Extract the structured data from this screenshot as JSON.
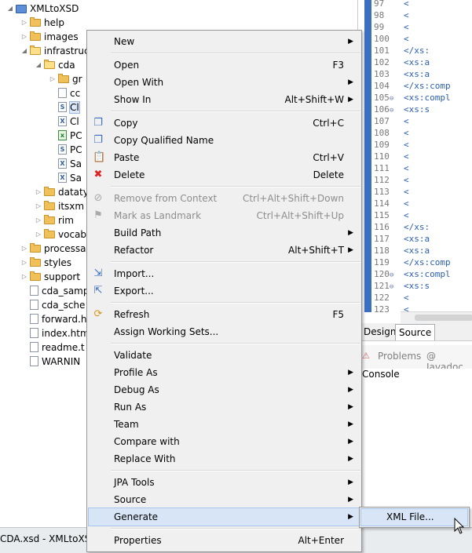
{
  "tree": [
    {
      "label": "XMLtoXSD",
      "icon": "project",
      "twisty": "open",
      "indent": 0
    },
    {
      "label": "help",
      "icon": "folder",
      "twisty": "closed",
      "indent": 1
    },
    {
      "label": "images",
      "icon": "folder",
      "twisty": "closed",
      "indent": 1
    },
    {
      "label": "infrastruc",
      "icon": "folder-open",
      "twisty": "open",
      "indent": 1
    },
    {
      "label": "cda",
      "icon": "folder-open",
      "twisty": "open",
      "indent": 2
    },
    {
      "label": "gr",
      "icon": "folder",
      "twisty": "closed",
      "indent": 3
    },
    {
      "label": "cc",
      "icon": "file",
      "twisty": "",
      "indent": 3
    },
    {
      "label": "Cl",
      "icon": "xsd-file",
      "twisty": "",
      "indent": 3,
      "selected": true
    },
    {
      "label": "Cl",
      "icon": "xml-file",
      "twisty": "",
      "indent": 3
    },
    {
      "label": "PC",
      "icon": "gif-file",
      "twisty": "",
      "indent": 3
    },
    {
      "label": "PC",
      "icon": "xsd-file",
      "twisty": "",
      "indent": 3
    },
    {
      "label": "Sa",
      "icon": "xml-file",
      "twisty": "",
      "indent": 3
    },
    {
      "label": "Sa",
      "icon": "xml-file",
      "twisty": "",
      "indent": 3
    },
    {
      "label": "dataty",
      "icon": "folder",
      "twisty": "closed",
      "indent": 2
    },
    {
      "label": "itsxm",
      "icon": "folder",
      "twisty": "closed",
      "indent": 2
    },
    {
      "label": "rim",
      "icon": "folder",
      "twisty": "closed",
      "indent": 2
    },
    {
      "label": "vocab",
      "icon": "folder",
      "twisty": "closed",
      "indent": 2
    },
    {
      "label": "processal",
      "icon": "folder",
      "twisty": "closed",
      "indent": 1
    },
    {
      "label": "styles",
      "icon": "folder",
      "twisty": "closed",
      "indent": 1
    },
    {
      "label": "support",
      "icon": "folder",
      "twisty": "closed",
      "indent": 1
    },
    {
      "label": "cda_samp",
      "icon": "file",
      "twisty": "",
      "indent": 1
    },
    {
      "label": "cda_sche",
      "icon": "file",
      "twisty": "",
      "indent": 1
    },
    {
      "label": "forward.h",
      "icon": "file",
      "twisty": "",
      "indent": 1
    },
    {
      "label": "index.htm",
      "icon": "file",
      "twisty": "",
      "indent": 1
    },
    {
      "label": "readme.t",
      "icon": "file",
      "twisty": "",
      "indent": 1
    },
    {
      "label": "WARNIN",
      "icon": "file",
      "twisty": "",
      "indent": 1
    }
  ],
  "editor": {
    "lines": [
      {
        "n": "97",
        "fold": "",
        "code": "<"
      },
      {
        "n": "98",
        "fold": "",
        "code": "<"
      },
      {
        "n": "99",
        "fold": "",
        "code": "<"
      },
      {
        "n": "100",
        "fold": "",
        "code": "<"
      },
      {
        "n": "101",
        "fold": "",
        "code": "  </xs:"
      },
      {
        "n": "102",
        "fold": "",
        "code": "  <xs:a"
      },
      {
        "n": "103",
        "fold": "",
        "code": "  <xs:a"
      },
      {
        "n": "104",
        "fold": "",
        "code": "</xs:comp"
      },
      {
        "n": "105",
        "fold": "⊖",
        "code": "<xs:compl"
      },
      {
        "n": "106",
        "fold": "⊖",
        "code": "  <xs:s"
      },
      {
        "n": "107",
        "fold": "",
        "code": "     <"
      },
      {
        "n": "108",
        "fold": "",
        "code": "     <"
      },
      {
        "n": "109",
        "fold": "",
        "code": "     <"
      },
      {
        "n": "110",
        "fold": "",
        "code": "     <"
      },
      {
        "n": "111",
        "fold": "",
        "code": "     <"
      },
      {
        "n": "112",
        "fold": "",
        "code": "     <"
      },
      {
        "n": "113",
        "fold": "",
        "code": "     <"
      },
      {
        "n": "114",
        "fold": "",
        "code": "     <"
      },
      {
        "n": "115",
        "fold": "",
        "code": "     <"
      },
      {
        "n": "116",
        "fold": "",
        "code": "  </xs:"
      },
      {
        "n": "117",
        "fold": "",
        "code": "  <xs:a"
      },
      {
        "n": "118",
        "fold": "",
        "code": "  <xs:a"
      },
      {
        "n": "119",
        "fold": "",
        "code": "</xs:comp"
      },
      {
        "n": "120",
        "fold": "⊖",
        "code": "<xs:compl"
      },
      {
        "n": "121",
        "fold": "⊖",
        "code": "  <xs:s"
      },
      {
        "n": "122",
        "fold": "",
        "code": "     <"
      },
      {
        "n": "123",
        "fold": "",
        "code": "     <"
      }
    ],
    "tabs": {
      "design": "Design",
      "source": "Source"
    }
  },
  "views": {
    "problems": "Problems",
    "javadoc": "@ Javadoc",
    "console": "Console"
  },
  "status": {
    "text": "CDA.xsd - XMLtoXSD/"
  },
  "menu": {
    "items": [
      {
        "type": "item",
        "label": "New",
        "shortcut": "",
        "submenu": true,
        "icon": ""
      },
      {
        "type": "sep"
      },
      {
        "type": "item",
        "label": "Open",
        "shortcut": "F3",
        "submenu": false,
        "icon": ""
      },
      {
        "type": "item",
        "label": "Open With",
        "shortcut": "",
        "submenu": true,
        "icon": ""
      },
      {
        "type": "item",
        "label": "Show In",
        "shortcut": "Alt+Shift+W",
        "submenu": true,
        "icon": ""
      },
      {
        "type": "sep"
      },
      {
        "type": "item",
        "label": "Copy",
        "shortcut": "Ctrl+C",
        "submenu": false,
        "icon": "copy-icon"
      },
      {
        "type": "item",
        "label": "Copy Qualified Name",
        "shortcut": "",
        "submenu": false,
        "icon": "copy-qualified-icon"
      },
      {
        "type": "item",
        "label": "Paste",
        "shortcut": "Ctrl+V",
        "submenu": false,
        "icon": "paste-icon"
      },
      {
        "type": "item",
        "label": "Delete",
        "shortcut": "Delete",
        "submenu": false,
        "icon": "delete-icon"
      },
      {
        "type": "sep"
      },
      {
        "type": "item",
        "label": "Remove from Context",
        "shortcut": "Ctrl+Alt+Shift+Down",
        "submenu": false,
        "disabled": true,
        "icon": "remove-context-icon"
      },
      {
        "type": "item",
        "label": "Mark as Landmark",
        "shortcut": "Ctrl+Alt+Shift+Up",
        "submenu": false,
        "disabled": true,
        "icon": "landmark-icon"
      },
      {
        "type": "item",
        "label": "Build Path",
        "shortcut": "",
        "submenu": true,
        "icon": ""
      },
      {
        "type": "item",
        "label": "Refactor",
        "shortcut": "Alt+Shift+T",
        "submenu": true,
        "icon": ""
      },
      {
        "type": "sep"
      },
      {
        "type": "item",
        "label": "Import...",
        "shortcut": "",
        "submenu": false,
        "icon": "import-icon"
      },
      {
        "type": "item",
        "label": "Export...",
        "shortcut": "",
        "submenu": false,
        "icon": "export-icon"
      },
      {
        "type": "sep"
      },
      {
        "type": "item",
        "label": "Refresh",
        "shortcut": "F5",
        "submenu": false,
        "icon": "refresh-icon"
      },
      {
        "type": "item",
        "label": "Assign Working Sets...",
        "shortcut": "",
        "submenu": false,
        "icon": ""
      },
      {
        "type": "sep"
      },
      {
        "type": "item",
        "label": "Validate",
        "shortcut": "",
        "submenu": false,
        "icon": ""
      },
      {
        "type": "item",
        "label": "Profile As",
        "shortcut": "",
        "submenu": true,
        "icon": ""
      },
      {
        "type": "item",
        "label": "Debug As",
        "shortcut": "",
        "submenu": true,
        "icon": ""
      },
      {
        "type": "item",
        "label": "Run As",
        "shortcut": "",
        "submenu": true,
        "icon": ""
      },
      {
        "type": "item",
        "label": "Team",
        "shortcut": "",
        "submenu": true,
        "icon": ""
      },
      {
        "type": "item",
        "label": "Compare with",
        "shortcut": "",
        "submenu": true,
        "icon": ""
      },
      {
        "type": "item",
        "label": "Replace With",
        "shortcut": "",
        "submenu": true,
        "icon": ""
      },
      {
        "type": "sep"
      },
      {
        "type": "item",
        "label": "JPA Tools",
        "shortcut": "",
        "submenu": true,
        "icon": ""
      },
      {
        "type": "item",
        "label": "Source",
        "shortcut": "",
        "submenu": true,
        "icon": ""
      },
      {
        "type": "item",
        "label": "Generate",
        "shortcut": "",
        "submenu": true,
        "highlighted": true,
        "icon": ""
      },
      {
        "type": "sep"
      },
      {
        "type": "item",
        "label": "Properties",
        "shortcut": "Alt+Enter",
        "submenu": false,
        "icon": ""
      }
    ],
    "submenu": {
      "label": "XML File..."
    }
  }
}
